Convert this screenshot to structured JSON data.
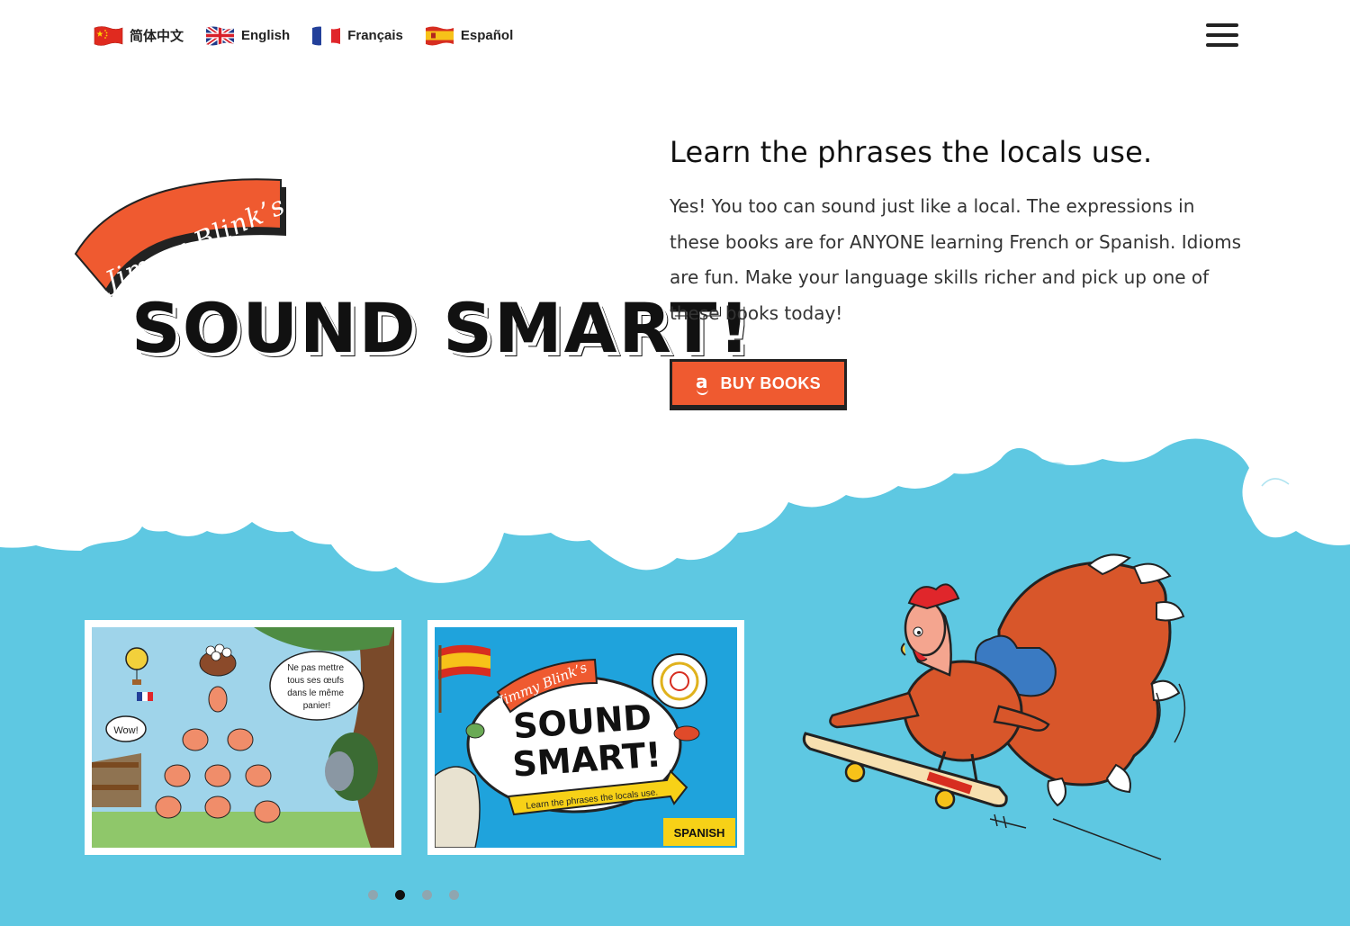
{
  "header": {
    "languages": [
      {
        "label": "简体中文",
        "icon": "china-flag-icon"
      },
      {
        "label": "English",
        "icon": "uk-flag-icon"
      },
      {
        "label": "Français",
        "icon": "france-flag-icon"
      },
      {
        "label": "Español",
        "icon": "spain-flag-icon"
      }
    ],
    "menu_icon": "hamburger-menu-icon"
  },
  "logo": {
    "banner_text": "Jimmy Blink’s",
    "title": "SOUND SMART!"
  },
  "intro": {
    "heading": "Learn the phrases the locals use.",
    "body": "Yes! You too can sound just like a local. The expressions in these books are for ANYONE learning French or Spanish. Idioms are fun. Make your language skills richer and pick up one of these books today!"
  },
  "buy_button": {
    "label": "BUY BOOKS",
    "icon": "amazon-icon"
  },
  "carousel": {
    "slides": [
      {
        "name": "french-book-cover",
        "bubble_text": [
          "Ne pas mettre",
          "tous ses œufs",
          "dans le même",
          "panier!"
        ],
        "wow_text": "Wow!"
      },
      {
        "name": "spanish-book-cover",
        "banner_text": "Jimmy Blink’s",
        "title_line1": "SOUND",
        "title_line2": "SMART!",
        "tagline": "Learn the phrases the locals use.",
        "language_badge": "SPANISH"
      }
    ],
    "dots": 4,
    "active_dot": 1
  },
  "colors": {
    "accent": "#ef5a30",
    "sky": "#5ec8e2",
    "dark": "#222222"
  }
}
